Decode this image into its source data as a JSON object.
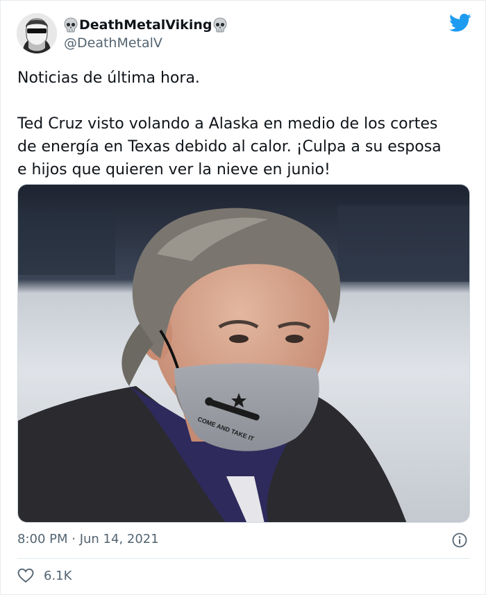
{
  "header": {
    "display_name": "DeathMetalViking",
    "handle": "@DeathMetalV",
    "name_prefix_icon": "skull-icon",
    "name_suffix_icon": "skull-icon",
    "brand_icon": "twitter-bird-icon"
  },
  "tweet": {
    "line1": "Noticias de última hora.",
    "line2": "Ted Cruz visto volando a Alaska en medio de los cortes",
    "line3": "de energía en Texas debido al calor. ¡Culpa a su esposa",
    "line4": "e hijos que quieren ver la nieve en junio!"
  },
  "media": {
    "mask_text": "COME AND TAKE IT"
  },
  "footer": {
    "timestamp": "8:00 PM · Jun 14, 2021",
    "like_count": "6.1K",
    "info_icon": "info-icon",
    "like_icon": "heart-icon"
  },
  "colors": {
    "brand": "#1d9bf0",
    "text": "#0f1419",
    "secondary": "#536471",
    "divider": "#e1e8ed"
  }
}
